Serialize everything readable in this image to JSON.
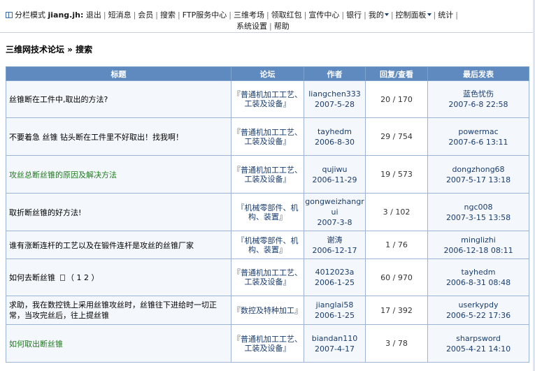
{
  "nav": {
    "mode_label": "分栏模式",
    "user": "jiang.jh:",
    "items": [
      "退出",
      "短消息",
      "会员",
      "搜索",
      "FTP服务中心",
      "三维考场",
      "领取红包",
      "宣传中心",
      "银行",
      "我的",
      "控制面板",
      "统计",
      "系统设置",
      "帮助"
    ]
  },
  "breadcrumb": "三维网技术论坛 » 搜索",
  "table": {
    "headers": [
      "标题",
      "论坛",
      "作者",
      "回复/查看",
      "最后发表"
    ],
    "rows": [
      {
        "title": "丝锥断在工件中,取出的方法?",
        "forum": "『普通机加工工艺、工装及设备』",
        "author": "liangchen333",
        "date": "2007-5-28",
        "stats": "20 / 170",
        "last_user": "蓝色忧伤",
        "last_date": "2007-6-8 22:58"
      },
      {
        "title": "不要着急 丝锥 钻头断在工件里不好取出！找我啊！",
        "forum": "『普通机加工工艺、工装及设备』",
        "author": "tayhedm",
        "date": "2006-8-30",
        "stats": "29 / 754",
        "last_user": "powermac",
        "last_date": "2007-6-6 13:11"
      },
      {
        "title": "攻丝总断丝锥的原因及解决方法",
        "forum": "『普通机加工工艺、工装及设备』",
        "author": "qujiwu",
        "date": "2006-11-29",
        "stats": "19 / 573",
        "last_user": "dongzhong68",
        "last_date": "2007-5-17 13:18"
      },
      {
        "title": "取折断丝锥的好方法!",
        "forum": "『机械零部件、机构、装置』",
        "author": "gongweizhangrui",
        "date": "2007-3-8",
        "stats": "3 / 102",
        "last_user": "ngc008",
        "last_date": "2007-3-15 13:58"
      },
      {
        "title": "谁有涨断连杆的工艺以及在锻件连杆是攻丝的丝锥厂家",
        "forum": "『机械零部件、机构、装置』",
        "author": "谢涛",
        "date": "2006-12-17",
        "stats": "1 / 76",
        "last_user": "minglizhi",
        "last_date": "2006-12-18 08:11"
      },
      {
        "title": "如何去断丝锥",
        "pages": "（ 1 2 ）",
        "forum": "『普通机加工工艺、工装及设备』",
        "author": "4012023a",
        "date": "2006-1-25",
        "stats": "60 / 970",
        "last_user": "tayhedm",
        "last_date": "2006-8-31 08:48"
      },
      {
        "title": "求助，我在数控铣上采用丝锥攻丝时，丝锥往下进给时一切正常，当攻完丝后，往上提丝锥",
        "forum": "『数控及特种加工』",
        "author": "jianglai58",
        "date": "2006-1-25",
        "stats": "17 / 392",
        "last_user": "userkypdy",
        "last_date": "2006-5-22 17:36"
      },
      {
        "title": "如何取出断丝锥",
        "forum": "『普通机加工工艺、工装及设备』",
        "author": "biandan110",
        "date": "2007-4-17",
        "stats": "3 / 78",
        "last_user": "sharpsword",
        "last_date": "2005-4-21 14:10"
      }
    ]
  },
  "colors": {
    "header_bg": "#5f8ac0",
    "visited_link": "#1f7a1f",
    "link": "#1a3d6e"
  }
}
